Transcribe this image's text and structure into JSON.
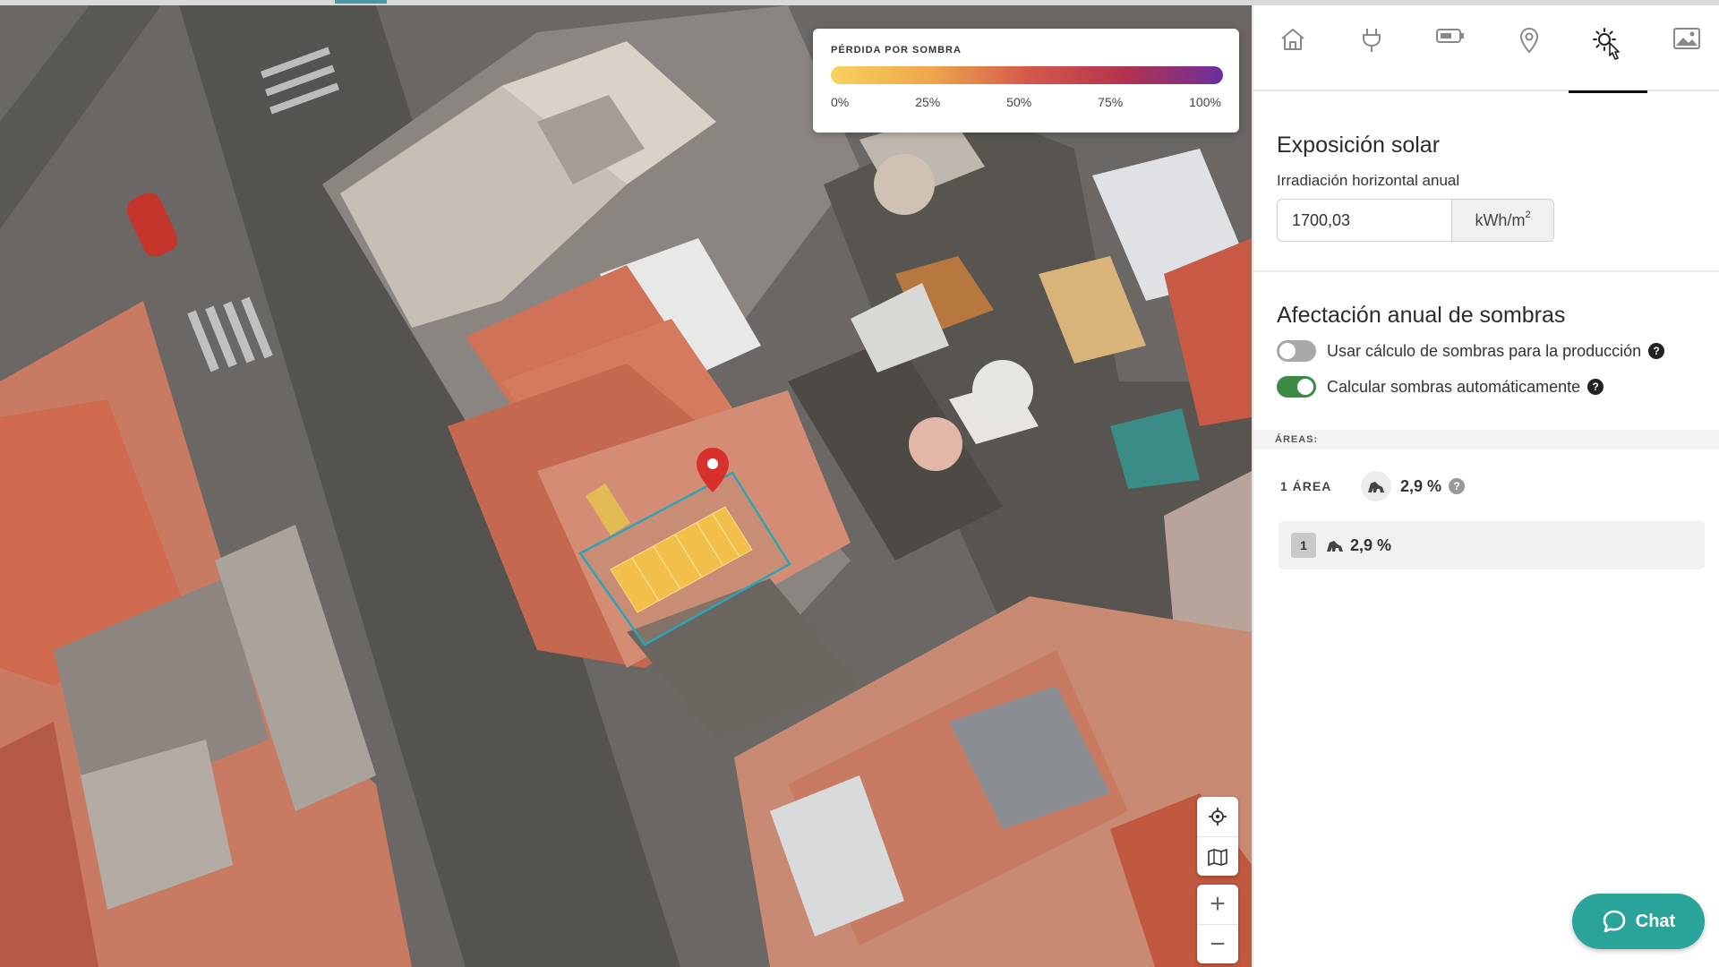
{
  "map": {
    "legend": {
      "title": "PÉRDIDA POR SOMBRA",
      "ticks": [
        "0%",
        "25%",
        "50%",
        "75%",
        "100%"
      ],
      "gradient_colors": [
        "#f7d15e",
        "#eea84c",
        "#d45a4b",
        "#b2334e",
        "#6b2f9e"
      ]
    },
    "controls": {
      "locate_icon": "crosshair-icon",
      "map_type_icon": "map-icon",
      "zoom_in": "+",
      "zoom_out": "−"
    }
  },
  "tabs": [
    {
      "icon": "home-icon",
      "active": false
    },
    {
      "icon": "plug-icon",
      "active": false
    },
    {
      "icon": "battery-icon",
      "active": false
    },
    {
      "icon": "location-pin-icon",
      "active": false
    },
    {
      "icon": "sun-icon",
      "active": true
    },
    {
      "icon": "image-icon",
      "active": false
    }
  ],
  "solar": {
    "title": "Exposición solar",
    "irradiation_label": "Irradiación horizontal anual",
    "irradiation_value": "1700,03",
    "unit": "kWh/m",
    "unit_sup": "2"
  },
  "shadows": {
    "title": "Afectación anual de sombras",
    "use_shadow_calc_label": "Usar cálculo de sombras para la producción",
    "use_shadow_calc_on": false,
    "auto_calc_label": "Calcular sombras automáticamente",
    "auto_calc_on": true,
    "help": "?"
  },
  "areas": {
    "header": "ÁREAS:",
    "summary_count": "1 ÁREA",
    "summary_pct": "2,9 %",
    "items": [
      {
        "index": "1",
        "pct": "2,9 %"
      }
    ]
  },
  "chat": {
    "label": "Chat"
  },
  "colors": {
    "accent": "#2aa39a",
    "toggle_on": "#3c8a45",
    "panel_outline": "#2aa5b8"
  }
}
